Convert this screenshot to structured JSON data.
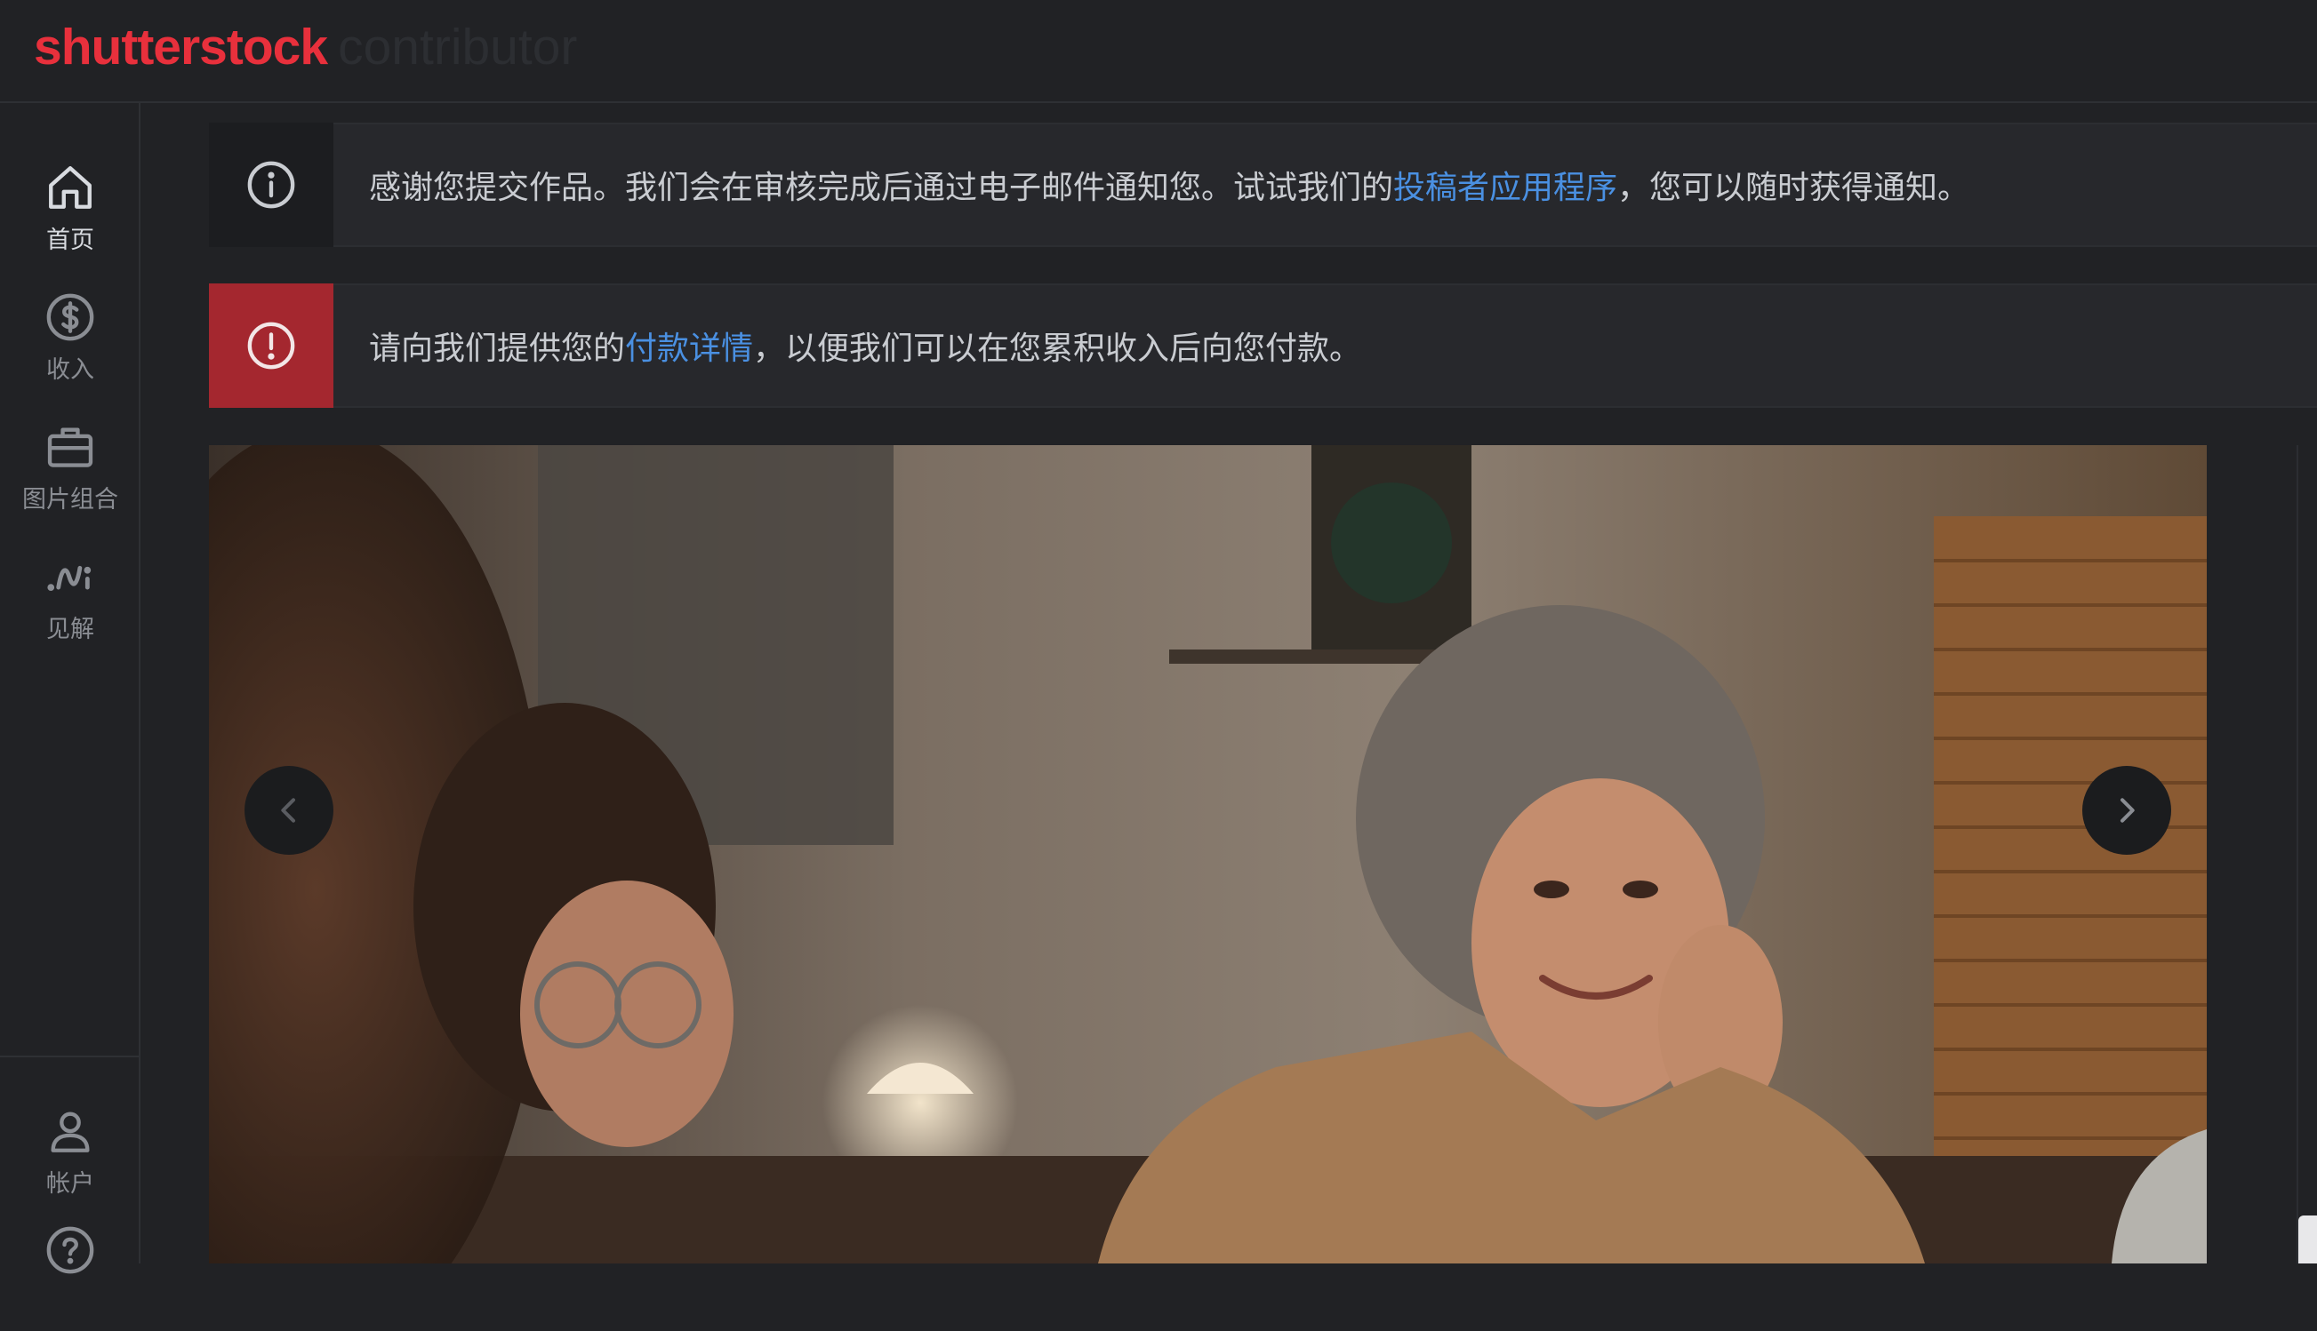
{
  "header": {
    "logo_brand": "shutterstock",
    "logo_sub": "contributor"
  },
  "sidebar": {
    "items": [
      {
        "label": "首页",
        "icon": "home-icon"
      },
      {
        "label": "收入",
        "icon": "dollar-icon"
      },
      {
        "label": "图片组合",
        "icon": "briefcase-icon"
      },
      {
        "label": "见解",
        "icon": "insights-icon"
      }
    ],
    "bottom_items": [
      {
        "label": "帐户",
        "icon": "user-icon"
      },
      {
        "label": "",
        "icon": "help-icon"
      }
    ]
  },
  "alerts": {
    "info": {
      "icon": "info-icon",
      "text_before": "感谢您提交作品。我们会在审核完成后通过电子邮件通知您。试试我们的",
      "link": "投稿者应用程序",
      "text_after": "，您可以随时获得通知。"
    },
    "error": {
      "icon": "exclamation-icon",
      "text_before": "请向我们提供您的",
      "link": "付款详情",
      "text_after": "，以便我们可以在您累积收入后向您付款。"
    }
  },
  "carousel": {
    "prev_icon": "chevron-left-icon",
    "next_icon": "chevron-right-icon"
  },
  "colors": {
    "background": "#212225",
    "brand": "#e8303c",
    "link": "#4a90e2",
    "error": "#a4272f"
  }
}
